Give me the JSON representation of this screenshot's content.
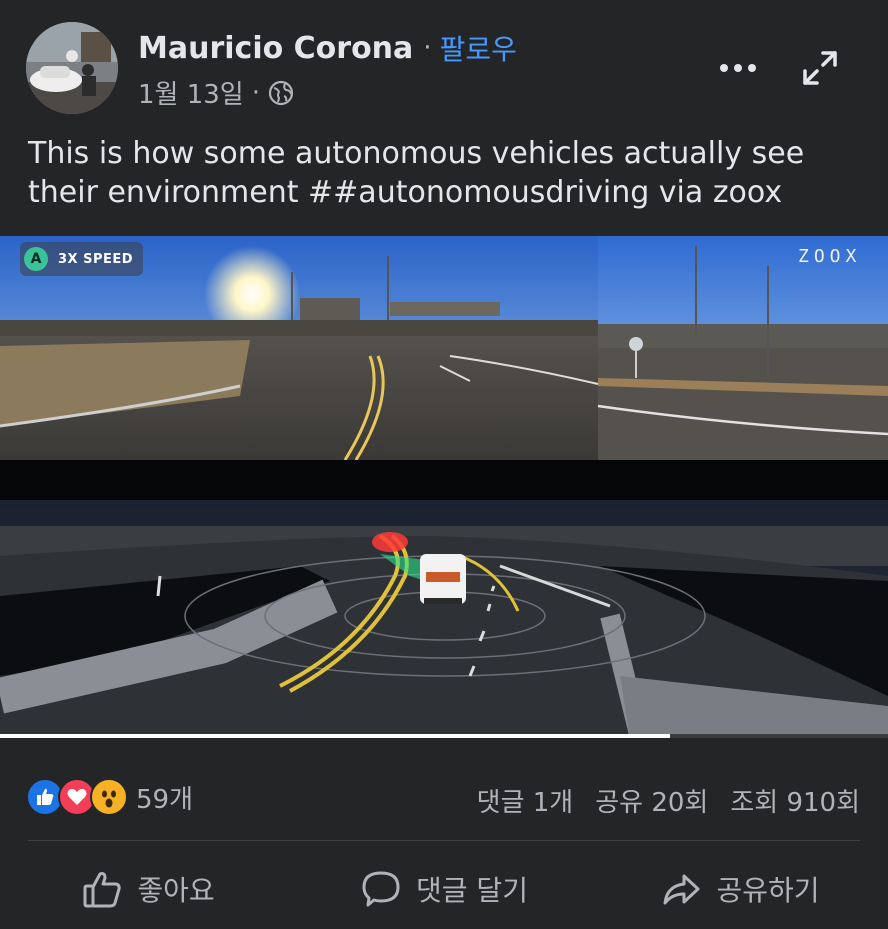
{
  "post": {
    "author": "Mauricio Corona",
    "separator": "·",
    "follow_label": "팔로우",
    "date": "1월 13일",
    "meta_separator": "·",
    "privacy_icon": "globe-icon",
    "more_icon": "more-horizontal-icon",
    "expand_icon": "expand-icon",
    "text": "This is how some autonomous vehicles actually see their environment ##autonomousdriving via zoox"
  },
  "video": {
    "badge_letter": "A",
    "speed_label": "3X SPEED",
    "brand_logo": "ZOOX",
    "progress": 0.755
  },
  "stats": {
    "reaction_icons": [
      "like-reaction-icon",
      "love-reaction-icon",
      "wow-reaction-icon"
    ],
    "reaction_count": "59개",
    "comments": "댓글 1개",
    "shares": "공유 20회",
    "views": "조회 910회"
  },
  "actions": {
    "like_label": "좋아요",
    "comment_label": "댓글 달기",
    "share_label": "공유하기"
  },
  "colors": {
    "background": "#242526",
    "follow": "#4599ff",
    "like": "#1b74e4",
    "love": "#f33e58",
    "wow": "#f7b125"
  }
}
